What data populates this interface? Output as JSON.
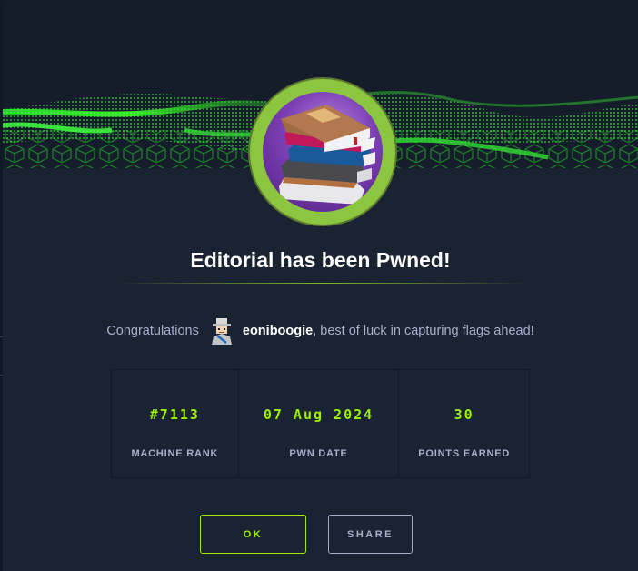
{
  "dialog": {
    "title": "Editorial has been Pwned!",
    "badge_icon": "book-stack-icon",
    "congrats_prefix": "Congratulations",
    "username": "eoniboogie",
    "congrats_suffix": ", best of luck in capturing flags ahead!"
  },
  "stats": [
    {
      "value": "#7113",
      "label": "MACHINE RANK"
    },
    {
      "value": "07 Aug 2024",
      "label": "PWN DATE"
    },
    {
      "value": "30",
      "label": "POINTS EARNED"
    }
  ],
  "buttons": {
    "ok_label": "OK",
    "share_label": "SHARE"
  },
  "colors": {
    "accent": "#9fef00",
    "badge_ring": "#8cc53f",
    "text_muted": "#a4b1cd",
    "background": "#1a2332"
  }
}
